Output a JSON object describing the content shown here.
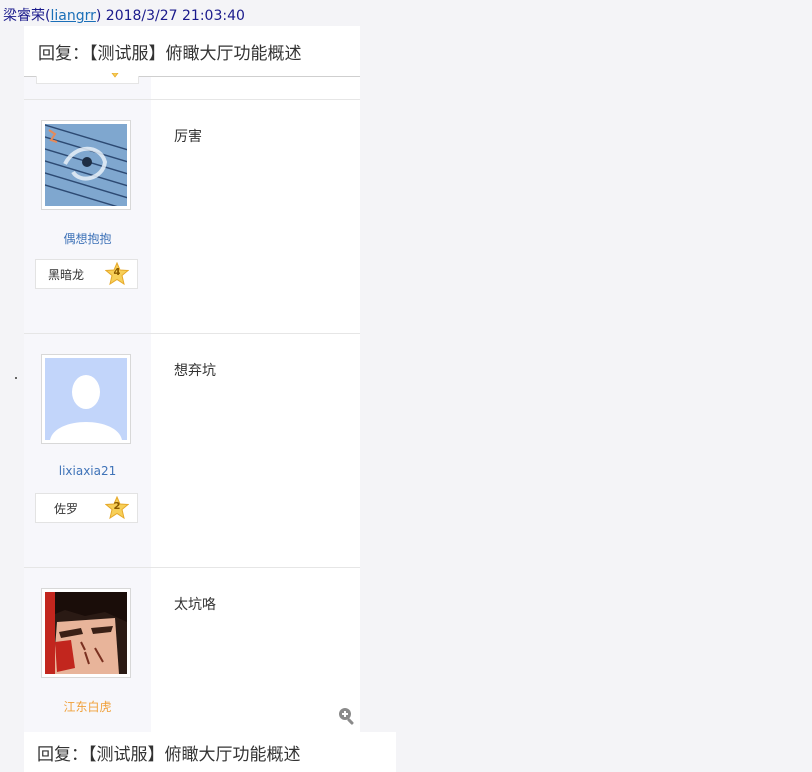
{
  "meta": {
    "author_name": "梁睿荣",
    "author_id": "liangrr",
    "timestamp": "2018/3/27 21:03:40"
  },
  "header": {
    "title": "回复：【测试服】俯瞰大厅功能概述"
  },
  "posts": [
    {
      "username": "偶想抱抱",
      "rank": "黑暗龙",
      "level": "4",
      "content": "厉害",
      "name_color": "#3f73b8"
    },
    {
      "username": "lixiaxia21",
      "rank": "佐罗",
      "level": "2",
      "content": "想弃坑",
      "name_color": "#3f73b8"
    },
    {
      "username": "江东白虎",
      "rank": "",
      "level": "",
      "content": "太坑咯",
      "name_color": "#f0a13b"
    }
  ],
  "footer": {
    "title": "回复：【测试服】俯瞰大厅功能概述"
  },
  "icons": {
    "zoom": "zoom-in-icon",
    "star": "level-star-icon"
  },
  "colors": {
    "link": "#3f73b8",
    "gold_name": "#f0a13b",
    "star_fill": "#f7cf58"
  }
}
